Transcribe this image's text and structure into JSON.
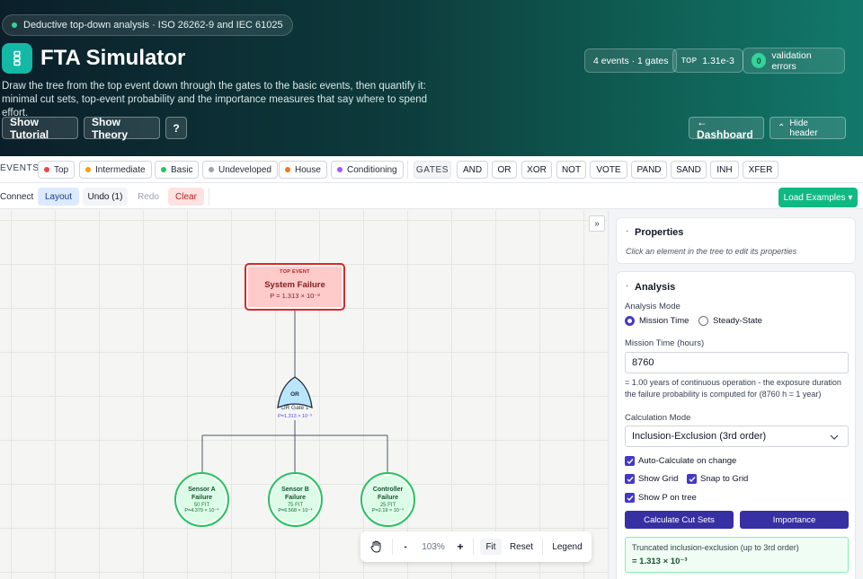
{
  "header": {
    "pill": "Deductive top-down analysis · ISO 26262-9 and IEC 61025",
    "title": "FTA Simulator",
    "subtitle": "Draw the tree from the top event down through the gates to the basic events, then quantify it: minimal cut sets, top-event probability and the importance measures that say where to spend effort.",
    "buttons": {
      "tutorial": "Show Tutorial",
      "theory": "Show Theory",
      "help": "?",
      "dashboard": "← Dashboard",
      "hide": "Hide header"
    },
    "stats": {
      "counts": "4 events · 1 gates",
      "top_key": "TOP",
      "top_value": "1.31e-3",
      "errors_count": "0",
      "errors_label": "validation errors"
    }
  },
  "toolbar": {
    "events_label": "EVENTS",
    "events": [
      {
        "label": "Top",
        "color": "#ef4444"
      },
      {
        "label": "Intermediate",
        "color": "#f59e0b"
      },
      {
        "label": "Basic",
        "color": "#22c55e"
      },
      {
        "label": "Undeveloped",
        "color": "#9ca3af"
      },
      {
        "label": "House",
        "color": "#f97316"
      },
      {
        "label": "Conditioning",
        "color": "#a855f7"
      }
    ],
    "gates_label": "GATES",
    "gates": [
      "AND",
      "OR",
      "XOR",
      "NOT",
      "VOTE",
      "PAND",
      "SAND",
      "INH",
      "XFER"
    ],
    "actions": {
      "connect": "Connect",
      "layout": "Layout",
      "undo": "Undo (1)",
      "redo": "Redo",
      "clear": "Clear"
    },
    "load_examples": "Load Examples ▾"
  },
  "tree": {
    "top": {
      "kind": "TOP EVENT",
      "name": "System Failure",
      "prob": "P = 1.313 × 10⁻³"
    },
    "gate": {
      "type": "OR",
      "name": "OR Gate 1",
      "prob": "P=1.313 × 10⁻³"
    },
    "basic": [
      {
        "name1": "Sensor A",
        "name2": "Failure",
        "fit": "50 FIT",
        "prob": "P=4.379 × 10⁻⁴"
      },
      {
        "name1": "Sensor B",
        "name2": "Failure",
        "fit": "75 FIT",
        "prob": "P=6.568 × 10⁻⁴"
      },
      {
        "name1": "Controller",
        "name2": "Failure",
        "fit": "25 FIT",
        "prob": "P=2.19 × 10⁻⁴"
      }
    ]
  },
  "zoom": {
    "level": "103%",
    "minus": "-",
    "plus": "+",
    "fit": "Fit",
    "reset": "Reset",
    "legend": "Legend",
    "collapse": "»"
  },
  "panel": {
    "properties": {
      "title": "Properties",
      "hint": "Click an element in the tree to edit its properties"
    },
    "analysis": {
      "title": "Analysis",
      "mode_label": "Analysis Mode",
      "mode_mission": "Mission Time",
      "mode_steady": "Steady-State",
      "mission_label": "Mission Time (hours)",
      "mission_value": "8760",
      "mission_note": "= 1.00 years of continuous operation - the exposure duration the failure probability is computed for (8760 h = 1 year)",
      "calc_label": "Calculation Mode",
      "calc_value": "Inclusion-Exclusion (3rd order)",
      "auto_calc": "Auto-Calculate on change",
      "show_grid": "Show Grid",
      "snap_grid": "Snap to Grid",
      "show_p": "Show P on tree",
      "btn_cutsets": "Calculate Cut Sets",
      "btn_importance": "Importance",
      "result_label": "Truncated inclusion-exclusion (up to 3rd order)",
      "result_value": "= 1.313 × 10⁻³"
    }
  }
}
